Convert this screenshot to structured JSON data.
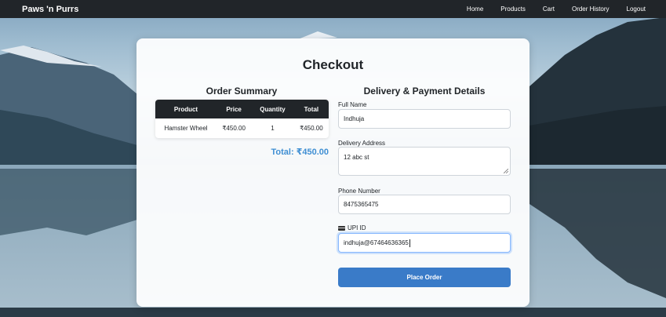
{
  "navbar": {
    "brand": "Paws 'n Purrs",
    "links": [
      "Home",
      "Products",
      "Cart",
      "Order History",
      "Logout"
    ]
  },
  "checkout": {
    "title": "Checkout",
    "summary_heading": "Order Summary",
    "details_heading": "Delivery & Payment Details",
    "table": {
      "headers": [
        "Product",
        "Price",
        "Quantity",
        "Total"
      ],
      "rows": [
        [
          "Hamster Wheel",
          "₹450.00",
          "1",
          "₹450.00"
        ]
      ]
    },
    "total": "Total: ₹450.00",
    "form": {
      "full_name_label": "Full Name",
      "full_name_value": "Indhuja",
      "address_label": "Delivery Address",
      "address_value": "12 abc st",
      "phone_label": "Phone Number",
      "phone_value": "8475365475",
      "upi_label": "UPI ID",
      "upi_value": "indhuja@67464636365"
    },
    "place_order": "Place Order"
  },
  "colors": {
    "navbar": "#212529",
    "accent": "#3a7bc8",
    "total": "#3f8fd3"
  }
}
